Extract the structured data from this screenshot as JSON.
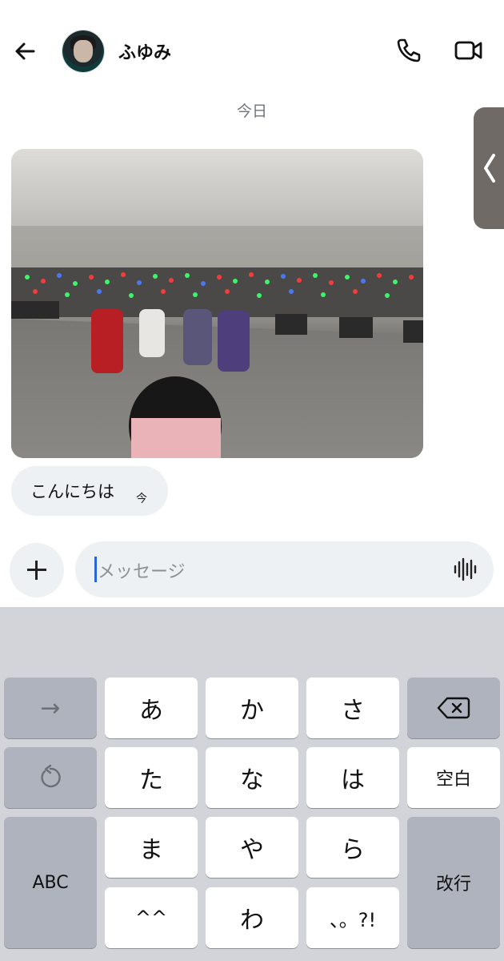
{
  "header": {
    "contact_name": "ふゆみ",
    "icons": {
      "back": "back-arrow-icon",
      "call": "phone-icon",
      "video": "video-camera-icon"
    }
  },
  "chat": {
    "date_label": "今日",
    "messages": [
      {
        "type": "image",
        "description_icon": "photo-attachment"
      },
      {
        "type": "text",
        "text": "こんにちは",
        "time": "今"
      }
    ]
  },
  "composer": {
    "placeholder": "メッセージ",
    "icons": {
      "add": "plus-icon",
      "voice": "voice-waveform-icon"
    }
  },
  "keyboard": {
    "rows": [
      [
        "→",
        "あ",
        "か",
        "さ",
        "backspace"
      ],
      [
        "undo",
        "た",
        "な",
        "は",
        "空白"
      ],
      [
        "ABC",
        "ま",
        "や",
        "ら",
        "改行"
      ],
      [
        "^^",
        "わ",
        "、。?!"
      ]
    ],
    "labels": {
      "arrow": "→",
      "a": "あ",
      "ka": "か",
      "sa": "さ",
      "ta": "た",
      "na": "な",
      "ha": "は",
      "space": "空白",
      "abc": "ABC",
      "ma": "ま",
      "ya": "や",
      "ra": "ら",
      "enter": "改行",
      "emoticon": "^^",
      "wa": "わ",
      "punct": "、。?!"
    }
  },
  "colors": {
    "bubble_bg": "#eef1f3",
    "keyboard_bg": "#d2d4d9",
    "func_key": "#aeb3bd",
    "caret": "#2a66d6"
  }
}
